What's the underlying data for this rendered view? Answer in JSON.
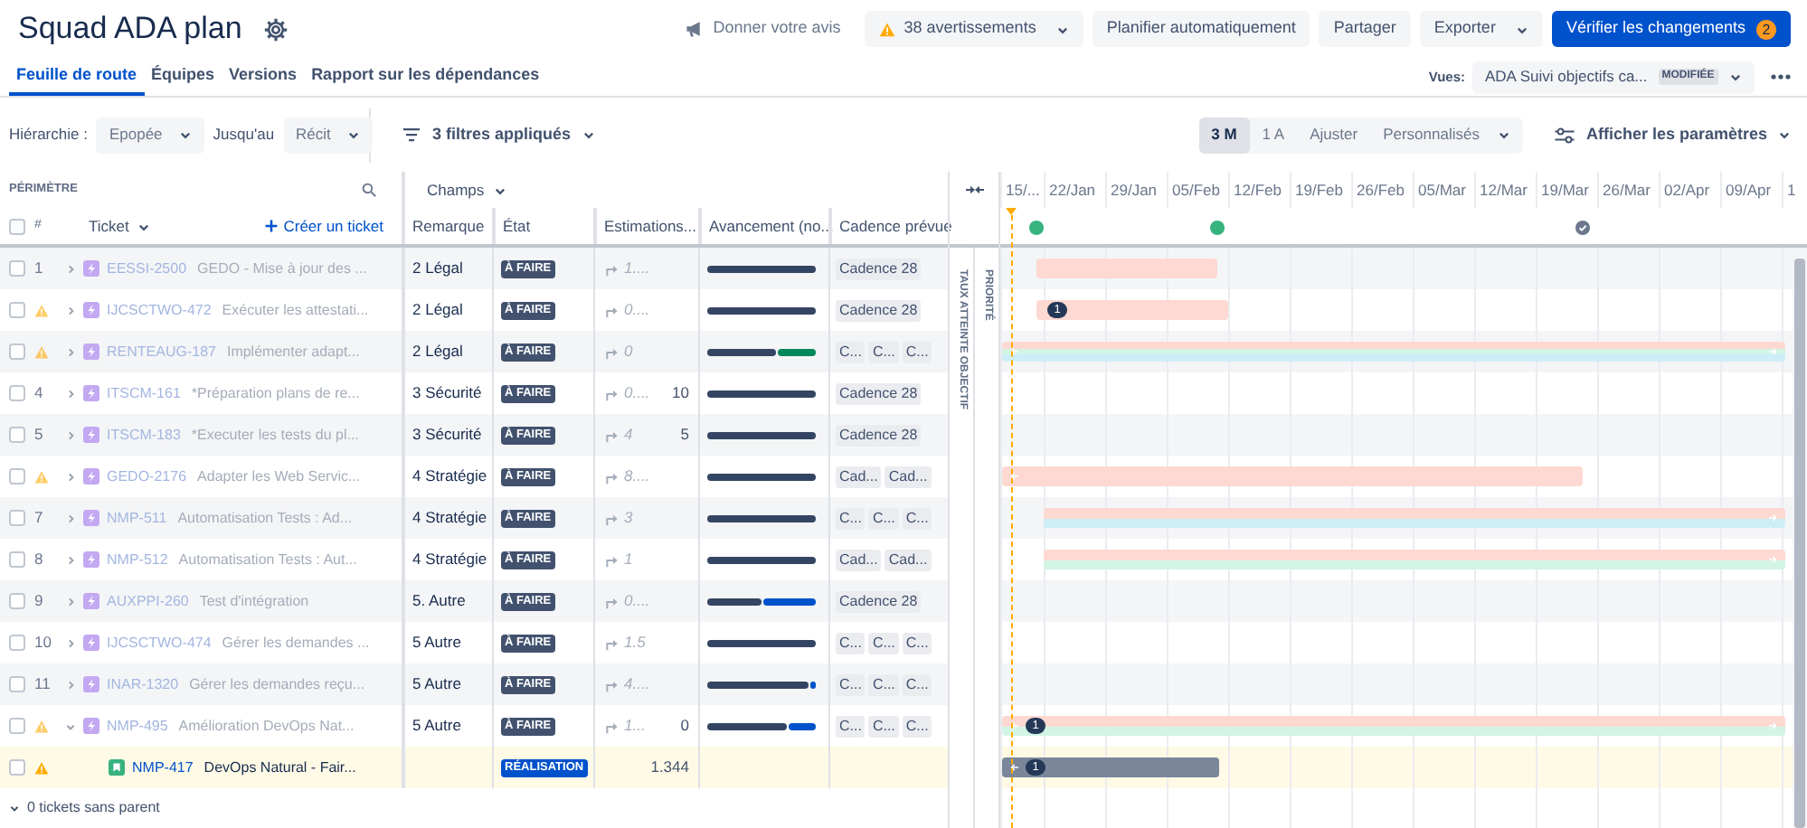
{
  "title": "Squad ADA plan",
  "header_buttons": [
    {
      "kind": "feedback",
      "label": "Donner votre avis"
    },
    {
      "kind": "warnings",
      "label": "38 avertissements"
    },
    {
      "kind": "plain",
      "label": "Planifier automatiquement"
    },
    {
      "kind": "plain",
      "label": "Partager"
    },
    {
      "kind": "dropdown",
      "label": "Exporter"
    },
    {
      "kind": "primary",
      "label": "Vérifier les changements",
      "badge": "2"
    }
  ],
  "tabs": [
    {
      "label": "Feuille de route",
      "selected": true
    },
    {
      "label": "Équipes",
      "selected": false
    },
    {
      "label": "Versions",
      "selected": false
    },
    {
      "label": "Rapport sur les dépendances",
      "selected": false
    }
  ],
  "views": {
    "label": "Vues:",
    "value": "ADA Suivi objectifs ca...",
    "badge": "MODIFIÉE"
  },
  "toolbar": {
    "hierarchy_label": "Hiérarchie :",
    "hierarchy_from": "Epopée",
    "until_label": "Jusqu'au",
    "hierarchy_to": "Récit",
    "filters": "3 filtres appliqués",
    "ranges": [
      {
        "label": "3 M",
        "selected": true,
        "dropdown": false
      },
      {
        "label": "1 A",
        "selected": false,
        "dropdown": false
      },
      {
        "label": "Ajuster",
        "selected": false,
        "dropdown": false
      },
      {
        "label": "Personnalisés",
        "selected": false,
        "dropdown": true
      }
    ],
    "settings": "Afficher les paramètres"
  },
  "scope": {
    "select_all_checked": false,
    "title": "PÉRIMÈTRE",
    "fields": "Champs",
    "number": "#",
    "ticket": "Ticket",
    "create": "Créer un ticket",
    "columns": [
      "Remarque",
      "État",
      "Estimations...",
      "Avancement (no...",
      "Cadence prévue"
    ]
  },
  "vertical_labels": [
    "TAUX ATTEINTE OBJECTIF",
    "PRIORITÉ"
  ],
  "timeline": {
    "weeks": [
      "15/...",
      "22/Jan",
      "29/Jan",
      "05/Feb",
      "12/Feb",
      "19/Feb",
      "26/Feb",
      "05/Mar",
      "12/Mar",
      "19/Mar",
      "26/Mar",
      "02/Apr",
      "09/Apr",
      "1"
    ],
    "milestones": [
      {
        "kind": "released"
      },
      {
        "kind": "released"
      },
      {
        "kind": "archived"
      }
    ]
  },
  "rows": [
    {
      "number": "1",
      "warning": false,
      "checked": false,
      "expanded": false,
      "kind": "epic",
      "key": "EESSI-2500",
      "title": "GEDO - Mise à jour des ...",
      "dimmed": true,
      "selected": false,
      "remark": "2 Légal",
      "status": {
        "kind": "todo",
        "label": "À FAIRE"
      },
      "estimate": "1....",
      "progress": [
        {
          "kind": "todo",
          "level": 1
        }
      ],
      "cadence": [
        "Cadence 28"
      ]
    },
    {
      "warning": true,
      "checked": false,
      "expanded": false,
      "kind": "epic",
      "key": "IJCSCTWO-472",
      "title": "Exécuter les attestati...",
      "dimmed": true,
      "selected": false,
      "remark": "2 Légal",
      "status": {
        "kind": "todo",
        "label": "À FAIRE"
      },
      "estimate": "0....",
      "progress": [
        {
          "kind": "todo",
          "level": 1
        }
      ],
      "cadence": [
        "Cadence 28"
      ],
      "timeline_badge": "1"
    },
    {
      "warning": true,
      "checked": false,
      "expanded": false,
      "kind": "epic",
      "key": "RENTEAUG-187",
      "title": "Implémenter adapt...",
      "dimmed": true,
      "selected": false,
      "remark": "2 Légal",
      "status": {
        "kind": "todo",
        "label": "À FAIRE"
      },
      "estimate": "0",
      "progress": [
        {
          "kind": "todo",
          "level": 0.65
        },
        {
          "kind": "done",
          "level": 0.35
        }
      ],
      "cadence": [
        "C...",
        "C...",
        "C..."
      ]
    },
    {
      "number": "4",
      "warning": false,
      "checked": false,
      "expanded": false,
      "kind": "epic",
      "key": "ITSCM-161",
      "title": "*Préparation plans de re...",
      "dimmed": true,
      "selected": false,
      "remark": "3 Sécurité",
      "status": {
        "kind": "todo",
        "label": "À FAIRE"
      },
      "estimate": "0....",
      "estimate_total": "10",
      "progress": [
        {
          "kind": "todo",
          "level": 1
        }
      ],
      "cadence": [
        "Cadence 28"
      ]
    },
    {
      "number": "5",
      "warning": false,
      "checked": false,
      "expanded": false,
      "kind": "epic",
      "key": "ITSCM-183",
      "title": "*Executer les tests du pl...",
      "dimmed": true,
      "selected": false,
      "remark": "3 Sécurité",
      "status": {
        "kind": "todo",
        "label": "À FAIRE"
      },
      "estimate": "4",
      "estimate_total": "5",
      "progress": [
        {
          "kind": "todo",
          "level": 1
        }
      ],
      "cadence": [
        "Cadence 28"
      ]
    },
    {
      "warning": true,
      "checked": false,
      "expanded": false,
      "kind": "epic",
      "key": "GEDO-2176",
      "title": "Adapter les Web Servic...",
      "dimmed": true,
      "selected": false,
      "remark": "4 Stratégie",
      "status": {
        "kind": "todo",
        "label": "À FAIRE"
      },
      "estimate": "8....",
      "progress": [
        {
          "kind": "todo",
          "level": 1
        }
      ],
      "cadence": [
        "Cad...",
        "Cad..."
      ]
    },
    {
      "number": "7",
      "warning": false,
      "checked": false,
      "expanded": false,
      "kind": "epic",
      "key": "NMP-511",
      "title": "Automatisation Tests : Ad...",
      "dimmed": true,
      "selected": false,
      "remark": "4 Stratégie",
      "status": {
        "kind": "todo",
        "label": "À FAIRE"
      },
      "estimate": "3",
      "progress": [
        {
          "kind": "todo",
          "level": 1
        }
      ],
      "cadence": [
        "C...",
        "C...",
        "C..."
      ]
    },
    {
      "number": "8",
      "warning": false,
      "checked": false,
      "expanded": false,
      "kind": "epic",
      "key": "NMP-512",
      "title": "Automatisation Tests : Aut...",
      "dimmed": true,
      "selected": false,
      "remark": "4 Stratégie",
      "status": {
        "kind": "todo",
        "label": "À FAIRE"
      },
      "estimate": "1",
      "progress": [
        {
          "kind": "todo",
          "level": 1
        }
      ],
      "cadence": [
        "Cad...",
        "Cad..."
      ]
    },
    {
      "number": "9",
      "warning": false,
      "checked": false,
      "expanded": false,
      "kind": "epic",
      "key": "AUXPPI-260",
      "title": "Test d'intégration",
      "dimmed": true,
      "selected": false,
      "remark": "5. Autre",
      "status": {
        "kind": "todo",
        "label": "À FAIRE"
      },
      "estimate": "0....",
      "progress": [
        {
          "kind": "todo",
          "level": 0.5
        },
        {
          "kind": "in_progress",
          "level": 0.5
        }
      ],
      "cadence": [
        "Cadence 28"
      ]
    },
    {
      "number": "10",
      "warning": false,
      "checked": false,
      "expanded": false,
      "kind": "epic",
      "key": "IJCSCTWO-474",
      "title": "Gérer les demandes ...",
      "dimmed": true,
      "selected": false,
      "remark": "5 Autre",
      "status": {
        "kind": "todo",
        "label": "À FAIRE"
      },
      "estimate": "1.5",
      "progress": [
        {
          "kind": "todo",
          "level": 1
        }
      ],
      "cadence": [
        "C...",
        "C...",
        "C..."
      ]
    },
    {
      "number": "11",
      "warning": false,
      "checked": false,
      "expanded": false,
      "kind": "epic",
      "key": "INAR-1320",
      "title": "Gérer les demandes reçu...",
      "dimmed": true,
      "selected": false,
      "remark": "5 Autre",
      "status": {
        "kind": "todo",
        "label": "À FAIRE"
      },
      "estimate": "4....",
      "progress": [
        {
          "kind": "todo",
          "level": 0.95
        },
        {
          "kind": "in_progress",
          "level": 0.05
        }
      ],
      "cadence": [
        "C...",
        "C...",
        "C..."
      ]
    },
    {
      "warning": true,
      "checked": false,
      "expanded": true,
      "kind": "epic",
      "key": "NMP-495",
      "title": "Amélioration DevOps Nat...",
      "dimmed": true,
      "selected": false,
      "remark": "5 Autre",
      "status": {
        "kind": "todo",
        "label": "À FAIRE"
      },
      "estimate": "1...",
      "estimate_total": "0",
      "progress": [
        {
          "kind": "todo",
          "level": 0.75
        },
        {
          "kind": "in_progress",
          "level": 0.25
        }
      ],
      "cadence": [
        "C...",
        "C...",
        "C..."
      ],
      "timeline_badge": "1",
      "children": [
        {
          "warning": true,
          "checked": false,
          "kind": "story",
          "key": "NMP-417",
          "title": "DevOps Natural - Fair...",
          "dimmed": false,
          "selected": true,
          "status": {
            "kind": "in_progress",
            "label": "RÉALISATION"
          },
          "estimate_total": "1.344",
          "timeline_badge": "1"
        }
      ]
    }
  ],
  "footer": "0 tickets sans parent"
}
